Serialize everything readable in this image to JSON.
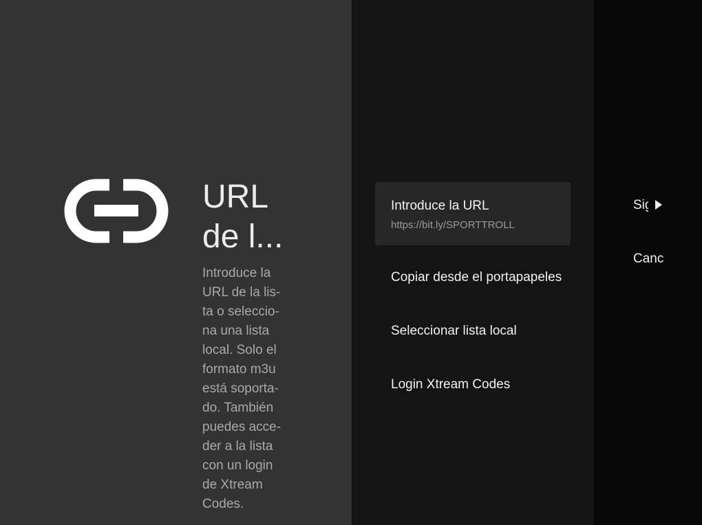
{
  "guidance": {
    "icon": "link-icon",
    "title": "URL\nde l...",
    "description_lines": [
      "Introduce la",
      "URL de la lis-",
      "ta o seleccio-",
      "na una lista",
      "local. Solo el",
      "formato m3u",
      "está soporta-",
      "do. También",
      "puedes acce-",
      "der a la lista",
      "con un login",
      "de Xtream",
      "Codes."
    ]
  },
  "actions": [
    {
      "title": "Introduce la URL",
      "description": "https://bit.ly/SPORTTROLL",
      "focused": true
    },
    {
      "title": "Copiar desde el portapapeles",
      "focused": false
    },
    {
      "title": "Seleccionar lista local",
      "focused": false
    },
    {
      "title": "Login Xtream Codes",
      "focused": false
    }
  ],
  "buttons": {
    "next_label": "Siguiente",
    "next_icon": "arrow-right-icon",
    "cancel_label": "Cancelar"
  },
  "colors": {
    "guidance_bg": "#333333",
    "actions_bg": "#141414",
    "buttons_bg": "#080808",
    "focused_bg": "#272727"
  }
}
